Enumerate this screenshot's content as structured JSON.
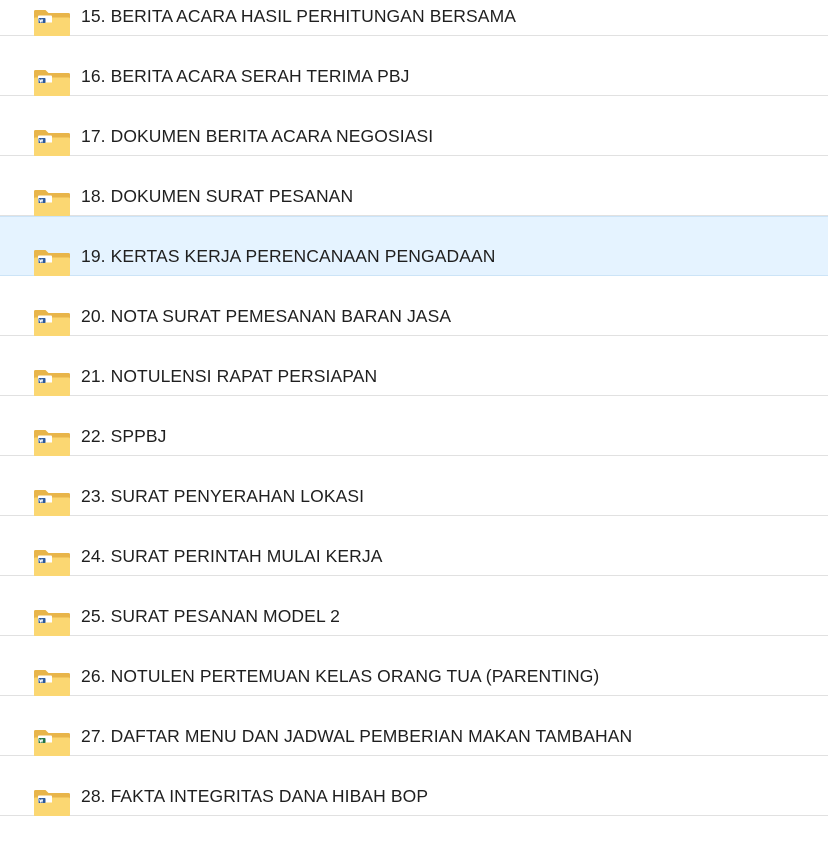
{
  "colors": {
    "selected_row": "#e5f3ff",
    "folder_back": "#e8b54a",
    "folder_front": "#fbd772",
    "sheet_paper": "#ffffff",
    "word_badge": "#2b579a",
    "excel_badge": "#217346"
  },
  "folders": [
    {
      "label": "15. BERITA ACARA HASIL PERHITUNGAN BERSAMA",
      "icon": "folder-word-icon"
    },
    {
      "label": "16. BERITA ACARA SERAH TERIMA PBJ",
      "icon": "folder-word-icon"
    },
    {
      "label": "17. DOKUMEN BERITA ACARA NEGOSIASI",
      "icon": "folder-word-icon"
    },
    {
      "label": "18. DOKUMEN SURAT PESANAN",
      "icon": "folder-word-icon"
    },
    {
      "label": "19. KERTAS KERJA PERENCANAAN PENGADAAN",
      "icon": "folder-word-icon",
      "selected": true
    },
    {
      "label": "20. NOTA SURAT PEMESANAN BARAN JASA",
      "icon": "folder-word-icon"
    },
    {
      "label": "21. NOTULENSI RAPAT PERSIAPAN",
      "icon": "folder-word-icon"
    },
    {
      "label": "22. SPPBJ",
      "icon": "folder-word-icon"
    },
    {
      "label": "23. SURAT PENYERAHAN LOKASI",
      "icon": "folder-word-icon"
    },
    {
      "label": "24. SURAT PERINTAH MULAI KERJA",
      "icon": "folder-word-icon"
    },
    {
      "label": "25. SURAT PESANAN MODEL 2",
      "icon": "folder-word-icon"
    },
    {
      "label": "26. NOTULEN PERTEMUAN KELAS ORANG TUA (PARENTING)",
      "icon": "folder-word-icon"
    },
    {
      "label": "27. DAFTAR MENU DAN JADWAL PEMBERIAN MAKAN TAMBAHAN",
      "icon": "folder-excel-icon"
    },
    {
      "label": "28. FAKTA INTEGRITAS DANA HIBAH BOP",
      "icon": "folder-word-icon"
    }
  ]
}
